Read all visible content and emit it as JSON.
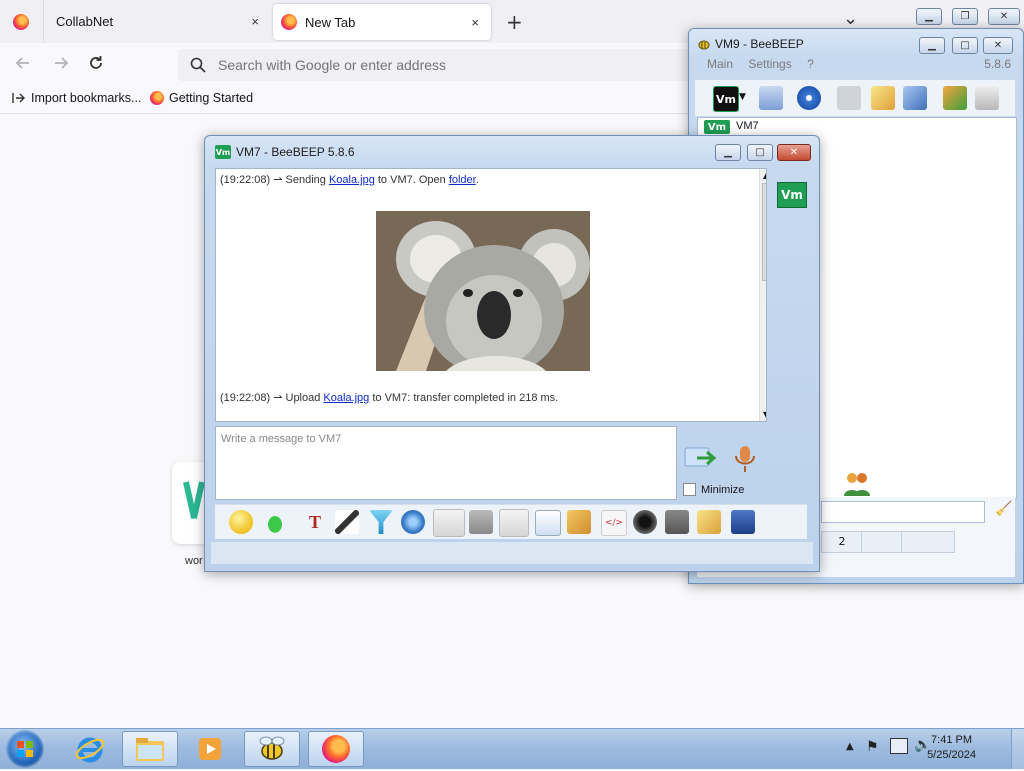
{
  "browser": {
    "tabs": [
      {
        "label": "CollabNet",
        "close": "×"
      },
      {
        "label": "New Tab",
        "close": "×"
      }
    ],
    "new_tab": "+",
    "list_tabs": "⌄",
    "url_placeholder": "Search with Google or enter address",
    "bookmarks": [
      {
        "label": "Import bookmarks..."
      },
      {
        "label": "Getting Started"
      }
    ],
    "tile_label": "wor"
  },
  "vm9": {
    "title": "VM9 - BeeBEEP",
    "menu": {
      "main": "Main",
      "settings": "Settings",
      "help": "?"
    },
    "version": "5.8.6",
    "user": "VM7",
    "bottom_tab": "2"
  },
  "vm7": {
    "title": "VM7 - BeeBEEP 5.8.6",
    "badge": "Vm",
    "messages": {
      "first": {
        "time": "(19:22:08)",
        "pre": "Sending",
        "file": "Koala.jpg",
        "mid": "to VM7. Open",
        "link": "folder",
        "post": "."
      },
      "second": {
        "time": "(19:22:08)",
        "pre": "Upload",
        "file": "Koala.jpg",
        "post": "to VM7: transfer completed in 218 ms."
      }
    },
    "input_placeholder": "Write a message to VM7",
    "minimize_label": "Minimize"
  },
  "taskbar": {
    "time": "7:41 PM",
    "date": "5/25/2024"
  },
  "colors": {
    "accent": "#1f9e54",
    "link": "#0a2bc9"
  }
}
